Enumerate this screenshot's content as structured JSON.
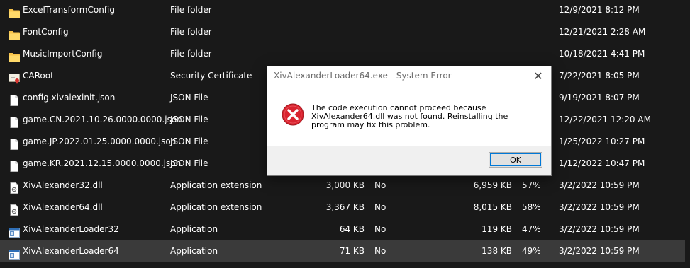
{
  "files": [
    {
      "name": "ExcelTransformConfig",
      "type": "File folder",
      "size": "",
      "enc": "",
      "psize": "",
      "ratio": "",
      "date": "12/9/2021 8:12 PM",
      "icon": "folder-icon"
    },
    {
      "name": "FontConfig",
      "type": "File folder",
      "size": "",
      "enc": "",
      "psize": "",
      "ratio": "",
      "date": "12/21/2021 2:28 AM",
      "icon": "folder-icon"
    },
    {
      "name": "MusicImportConfig",
      "type": "File folder",
      "size": "",
      "enc": "",
      "psize": "",
      "ratio": "",
      "date": "10/18/2021 4:41 PM",
      "icon": "folder-icon"
    },
    {
      "name": "CARoot",
      "type": "Security Certificate",
      "size": "",
      "enc": "",
      "psize": "",
      "ratio": "",
      "date": "7/22/2021 8:05 PM",
      "icon": "certificate-icon"
    },
    {
      "name": "config.xivalexinit.json",
      "type": "JSON File",
      "size": "",
      "enc": "",
      "psize": "",
      "ratio": "",
      "date": "9/19/2021 8:07 PM",
      "icon": "file-icon"
    },
    {
      "name": "game.CN.2021.10.26.0000.0000.json",
      "type": "JSON File",
      "size": "",
      "enc": "",
      "psize": "",
      "ratio": "",
      "date": "12/22/2021 12:20 AM",
      "icon": "file-icon"
    },
    {
      "name": "game.JP.2022.01.25.0000.0000.json",
      "type": "JSON File",
      "size": "",
      "enc": "",
      "psize": "",
      "ratio": "",
      "date": "1/25/2022 10:27 PM",
      "icon": "file-icon"
    },
    {
      "name": "game.KR.2021.12.15.0000.0000.json",
      "type": "JSON File",
      "size": "",
      "enc": "",
      "psize": "",
      "ratio": "",
      "date": "1/12/2022 10:47 PM",
      "icon": "file-icon"
    },
    {
      "name": "XivAlexander32.dll",
      "type": "Application extension",
      "size": "3,000 KB",
      "enc": "No",
      "psize": "6,959 KB",
      "ratio": "57%",
      "date": "3/2/2022 10:59 PM",
      "icon": "dll-icon"
    },
    {
      "name": "XivAlexander64.dll",
      "type": "Application extension",
      "size": "3,367 KB",
      "enc": "No",
      "psize": "8,015 KB",
      "ratio": "58%",
      "date": "3/2/2022 10:59 PM",
      "icon": "dll-icon"
    },
    {
      "name": "XivAlexanderLoader32",
      "type": "Application",
      "size": "64 KB",
      "enc": "No",
      "psize": "119 KB",
      "ratio": "47%",
      "date": "3/2/2022 10:59 PM",
      "icon": "application-icon"
    },
    {
      "name": "XivAlexanderLoader64",
      "type": "Application",
      "size": "71 KB",
      "enc": "No",
      "psize": "138 KB",
      "ratio": "49%",
      "date": "3/2/2022 10:59 PM",
      "icon": "application-icon",
      "selected": true
    }
  ],
  "dialog": {
    "title": "XivAlexanderLoader64.exe - System Error",
    "close_label": "✕",
    "message": "The code execution cannot proceed because XivAlexander64.dll was not found. Reinstalling the program may fix this problem.",
    "ok_label": "OK"
  },
  "colors": {
    "background": "#191919",
    "selected_row": "#3a3a3a",
    "folder": "#f8c34a",
    "error_red": "#d9232f"
  }
}
